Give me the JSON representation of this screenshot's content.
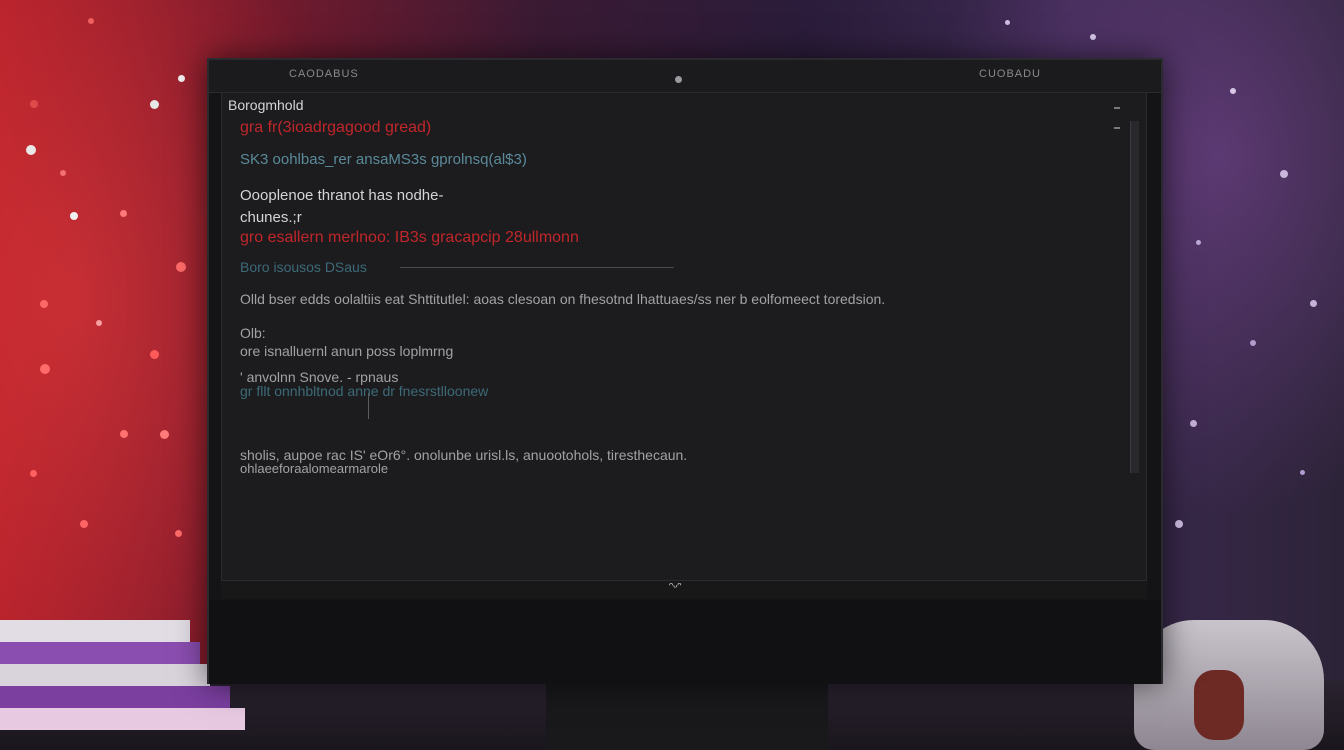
{
  "window": {
    "title_left": "CAODABUS",
    "title_right": "CUOBADU"
  },
  "editor": {
    "header": "Borogmhold",
    "lines": [
      {
        "text": "gra fr(3ioadrgagood gread)",
        "style": "red"
      },
      {
        "text": "SK3 oohlbas_rer ansaMS3s gprolnsq(al$3)",
        "style": "teal"
      },
      {
        "text": "Oooplenoe thranot has nodhe-",
        "style": "white"
      },
      {
        "text": "chunes.;r",
        "style": "white"
      },
      {
        "text": "gro esallern merlnoo: IB3s gracapcip 28ullmonn",
        "style": "red"
      },
      {
        "text": "Boro isousos DSaus",
        "style": "darkteal"
      },
      {
        "text": "Olld bser edds oolaltiis eat Shttitutlel: aoas clesoan on fhesotnd lhattuaes/ss ner b eolfomeect toredsion.",
        "style": "gray"
      },
      {
        "text": "Olb:",
        "style": "gray"
      },
      {
        "text": "ore isnalluernl anun poss loplmrng",
        "style": "gray"
      },
      {
        "text": "' anvolnn Snove. - rpnaus",
        "style": "gray"
      },
      {
        "text": "gr  fllt  onnhbltnod  anne dr fnesrstlloonew",
        "style": "darkteal"
      },
      {
        "text": "sholis, aupoe rac IS' eOr6°. onolunbe urisl.ls, anuootohols, tiresthecaun.",
        "style": "gray"
      },
      {
        "text": "ohlaeeforaalomearmarole",
        "style": "gray"
      }
    ]
  },
  "status": {
    "glyph": "ᵔᵕᵔ"
  },
  "colors": {
    "accent_red": "#c0262a",
    "editor_bg": "#1c1c1e",
    "text_gray": "#a2a2a6",
    "teal": "#5a8a9a"
  }
}
